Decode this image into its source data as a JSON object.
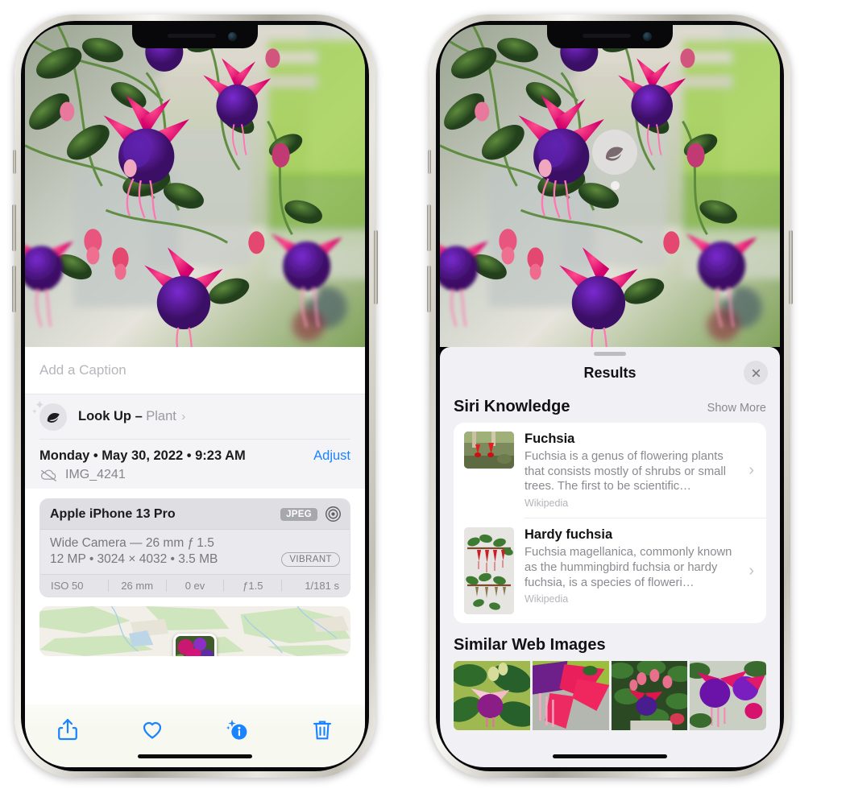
{
  "left_phone": {
    "caption": {
      "placeholder": "Add a Caption",
      "value": ""
    },
    "lookup": {
      "label": "Look Up –",
      "subject": "Plant",
      "icon": "leaf-icon",
      "chevron": "›"
    },
    "meta": {
      "date": "Monday • May 30, 2022 • 9:23 AM",
      "adjust_label": "Adjust",
      "filename": "IMG_4241",
      "cloud_icon": "cloud-slash-icon"
    },
    "camera": {
      "device": "Apple iPhone 13 Pro",
      "format_badge": "JPEG",
      "raw_icon": "raw-target-icon",
      "lens_line": "Wide Camera — 26 mm ƒ 1.5",
      "size_line": "12 MP • 3024 × 4032 • 3.5 MB",
      "style_badge": "VIBRANT",
      "exif": [
        "ISO 50",
        "26 mm",
        "0 ev",
        "ƒ1.5",
        "1/181 s"
      ]
    },
    "toolbar": [
      {
        "name": "share-icon",
        "label": "Share"
      },
      {
        "name": "heart-icon",
        "label": "Favorite"
      },
      {
        "name": "info-sparkle-icon",
        "label": "Info"
      },
      {
        "name": "trash-icon",
        "label": "Delete"
      }
    ]
  },
  "right_phone": {
    "visual_lookup_badge": {
      "icon": "leaf-icon"
    },
    "sheet": {
      "title": "Results",
      "close_icon": "close-icon"
    },
    "siri_knowledge": {
      "title": "Siri Knowledge",
      "show_more": "Show More",
      "items": [
        {
          "title": "Fuchsia",
          "description": "Fuchsia is a genus of flowering plants that consists mostly of shrubs or small trees. The first to be scientific…",
          "source": "Wikipedia",
          "chevron": "›"
        },
        {
          "title": "Hardy fuchsia",
          "description": "Fuchsia magellanica, commonly known as the hummingbird fuchsia or hardy fuchsia, is a species of floweri…",
          "source": "Wikipedia",
          "chevron": "›"
        }
      ]
    },
    "similar_web_images": {
      "title": "Similar Web Images",
      "thumbs": [
        "web-image-1",
        "web-image-2",
        "web-image-3",
        "web-image-4"
      ]
    }
  },
  "colors": {
    "accent_blue": "#1a84ff",
    "sheet_bg": "#f1f1f5",
    "card_bg": "#ffffff",
    "secondary_text": "#8a8a90",
    "frame_silver": "#d4d1c8"
  }
}
